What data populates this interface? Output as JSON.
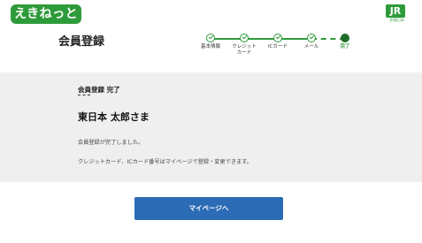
{
  "header": {
    "logo_text": "えきねっと",
    "jr_logo_text": "JR",
    "jr_logo_sub": "JR東日本"
  },
  "page_title": "会員登録",
  "stepper": {
    "steps": [
      {
        "label": "基本情報",
        "state": "done"
      },
      {
        "label": "クレジット\nカード",
        "state": "done"
      },
      {
        "label": "ICカード",
        "state": "done"
      },
      {
        "label": "メール",
        "state": "done"
      },
      {
        "label": "完了",
        "state": "current"
      }
    ],
    "accent_color": "#2e9b3a"
  },
  "section": {
    "title": "会員登録 完了",
    "name": "東日本 太郎さま",
    "message1": "会員登録が完了しました。",
    "message2": "クレジットカード、ICカード番号はマイページで登録・変更できます。"
  },
  "button": {
    "label": "マイページへ",
    "color": "#2c6bb5"
  }
}
